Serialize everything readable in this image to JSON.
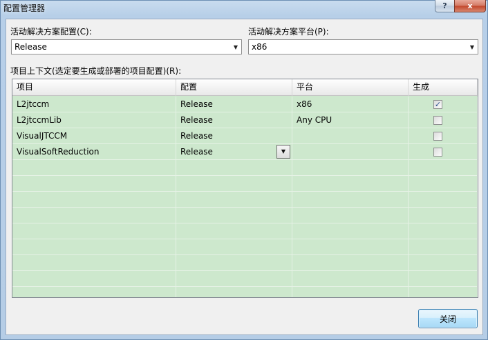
{
  "window": {
    "title": "配置管理器",
    "help_label": "?",
    "close_label": "x"
  },
  "active_config": {
    "label": "活动解决方案配置(C):",
    "value": "Release"
  },
  "active_platform": {
    "label": "活动解决方案平台(P):",
    "value": "x86"
  },
  "project_contexts_label": "项目上下文(选定要生成或部署的项目配置)(R):",
  "grid": {
    "columns": [
      "项目",
      "配置",
      "平台",
      "生成"
    ],
    "rows": [
      {
        "project": "L2jtccm",
        "config": "Release",
        "platform": "x86",
        "build": true
      },
      {
        "project": "L2jtccmLib",
        "config": "Release",
        "platform": "Any CPU",
        "build": false
      },
      {
        "project": "VisualJTCCM",
        "config": "Release",
        "platform": "",
        "build": false
      },
      {
        "project": "VisualSoftReduction",
        "config": "Release",
        "platform": "",
        "build": false
      }
    ],
    "check_glyph": "✓",
    "dropdown_glyph": "▼"
  },
  "footer": {
    "close_button": "关闭"
  },
  "colors": {
    "grid_bg": "#cde8cd",
    "button_border": "#3c7fb1"
  }
}
